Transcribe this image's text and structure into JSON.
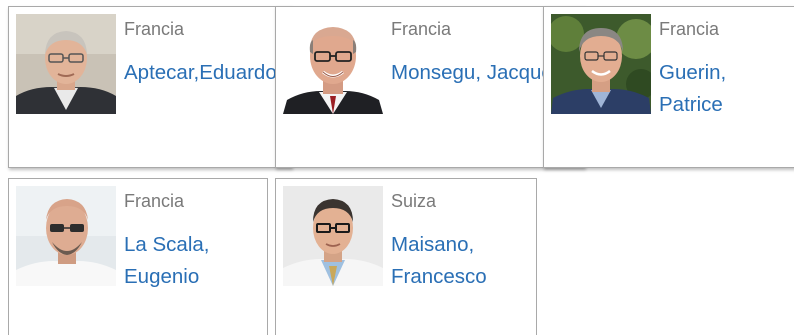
{
  "people": [
    {
      "country": "Francia",
      "name": "Aptecar,Eduardo"
    },
    {
      "country": "Francia",
      "name": "Monsegu, Jacques"
    },
    {
      "country": "Francia",
      "name": "Guerin, Patrice"
    },
    {
      "country": "Francia",
      "name": "La Scala, Eugenio"
    },
    {
      "country": "Suiza",
      "name": "Maisano, Francesco"
    }
  ],
  "colors": {
    "link": "#2a6fb5",
    "country": "#7a7a7a",
    "border": "#a9a9a9"
  }
}
